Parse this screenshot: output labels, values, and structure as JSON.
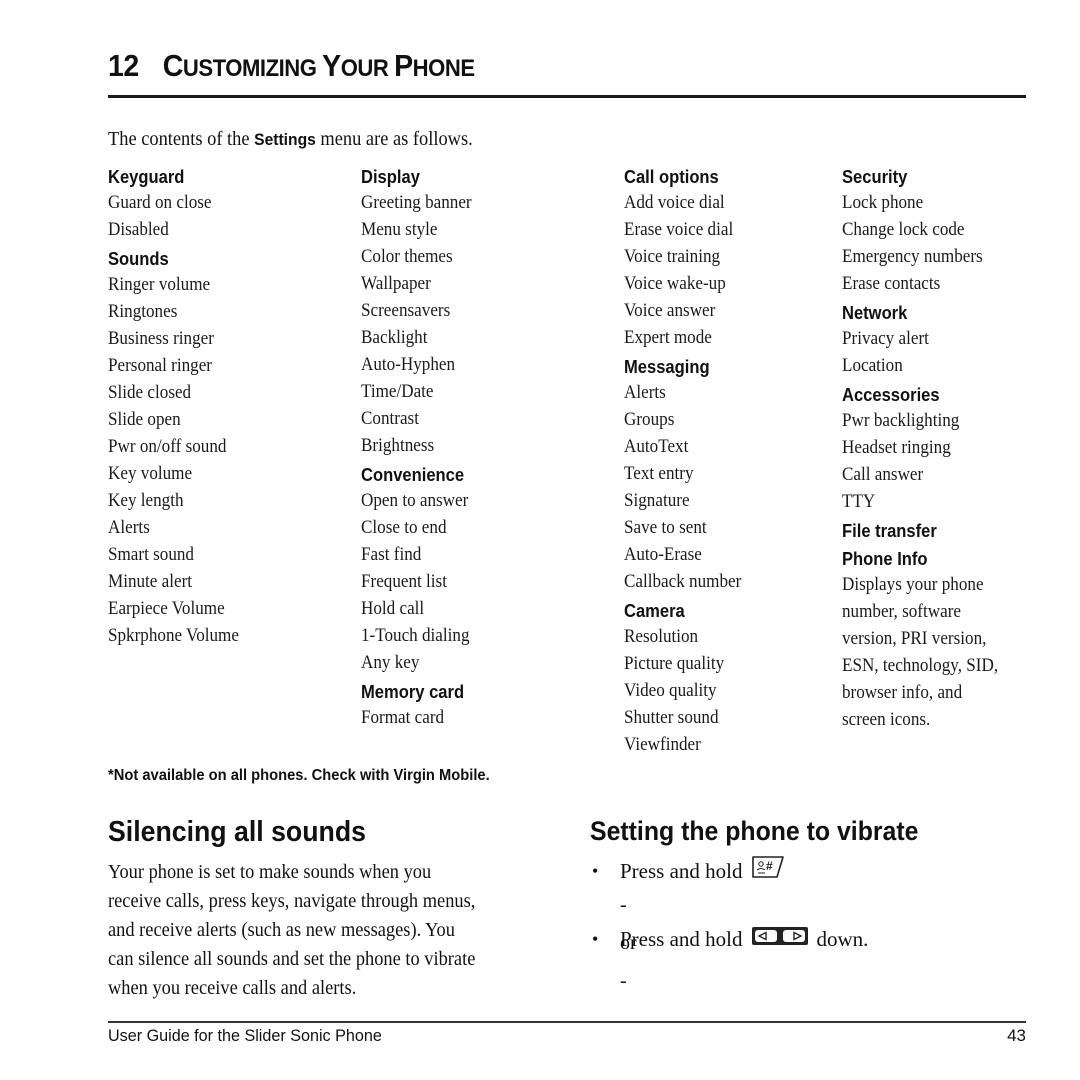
{
  "header": {
    "chapter_number": "12",
    "chapter_title_parts": [
      {
        "text": "C",
        "size": "big"
      },
      {
        "text": "USTOMIZING ",
        "size": "small"
      },
      {
        "text": "Y",
        "size": "big"
      },
      {
        "text": "OUR ",
        "size": "small"
      },
      {
        "text": "P",
        "size": "big"
      },
      {
        "text": "HONE",
        "size": "small"
      }
    ],
    "chapter_title": "Customizing Your Phone"
  },
  "intro": {
    "before": "The contents of the ",
    "keyword": "Settings",
    "after": " menu are as follows."
  },
  "columns": [
    {
      "groups": [
        {
          "title": "Keyguard",
          "items": [
            "Guard on close",
            "Disabled"
          ]
        },
        {
          "title": "Sounds",
          "items": [
            "Ringer volume",
            "Ringtones",
            "Business ringer",
            "Personal ringer",
            "Slide closed",
            "Slide open",
            "Pwr on/off sound",
            "Key volume",
            "Key length",
            "Alerts",
            "Smart sound",
            "Minute alert",
            "Earpiece Volume",
            "Spkrphone Volume"
          ]
        }
      ]
    },
    {
      "groups": [
        {
          "title": "Display",
          "items": [
            "Greeting banner",
            "Menu style",
            "Color themes",
            "Wallpaper",
            "Screensavers",
            "Backlight",
            "Auto-Hyphen",
            "Time/Date",
            "Contrast",
            "Brightness"
          ]
        },
        {
          "title": "Convenience",
          "items": [
            "Open to answer",
            "Close to end",
            "Fast find",
            "Frequent list",
            "Hold call",
            "1-Touch dialing",
            "Any key"
          ]
        },
        {
          "title": "Memory card",
          "items": [
            "Format card"
          ]
        }
      ]
    },
    {
      "groups": [
        {
          "title": "Call options",
          "items": [
            "Add voice dial",
            "Erase voice dial",
            "Voice training",
            "Voice wake-up",
            "Voice answer",
            "Expert mode"
          ]
        },
        {
          "title": "Messaging",
          "items": [
            "Alerts",
            "Groups",
            "AutoText",
            "Text entry",
            "Signature",
            "Save to sent",
            "Auto-Erase",
            "Callback number"
          ]
        },
        {
          "title": "Camera",
          "items": [
            "Resolution",
            "Picture quality",
            "Video quality",
            "Shutter sound",
            "Viewfinder"
          ]
        }
      ]
    },
    {
      "groups": [
        {
          "title": "Security",
          "items": [
            "Lock phone",
            "Change lock code",
            "Emergency numbers",
            "Erase contacts"
          ]
        },
        {
          "title": "Network",
          "items": [
            "Privacy alert",
            "Location"
          ]
        },
        {
          "title": "Accessories",
          "items": [
            "Pwr backlighting",
            "Headset ringing",
            "Call answer",
            "TTY"
          ]
        },
        {
          "title": "File transfer",
          "items": []
        },
        {
          "title": "Phone Info",
          "items": [],
          "description": [
            "Displays your phone",
            "number, software",
            "version, PRI version,",
            "ESN, technology, SID,",
            "browser info, and",
            "screen icons."
          ]
        }
      ]
    }
  ],
  "footnote": "*Not available on all phones. Check with Virgin Mobile.",
  "silencing": {
    "title": "Silencing all sounds",
    "paragraph_lines": [
      "Your phone is set to make sounds when you",
      "receive calls, press keys, navigate through menus,",
      "and receive alerts (such as new messages). You",
      "can silence all sounds and set the phone to vibrate",
      "when you receive calls and alerts."
    ]
  },
  "vibrate": {
    "title": "Setting the phone to vibrate",
    "bullet_1": {
      "text": "Press and hold",
      "icon": "pound-vibrate-key-icon"
    },
    "or_text": "- or -",
    "bullet_2": {
      "text": "Press and hold",
      "icon": "volume-side-key-icon",
      "after": "down."
    },
    "bullet_glyph": "•"
  },
  "footer": {
    "title": "User Guide for the Slider Sonic Phone",
    "page_number": "43"
  }
}
